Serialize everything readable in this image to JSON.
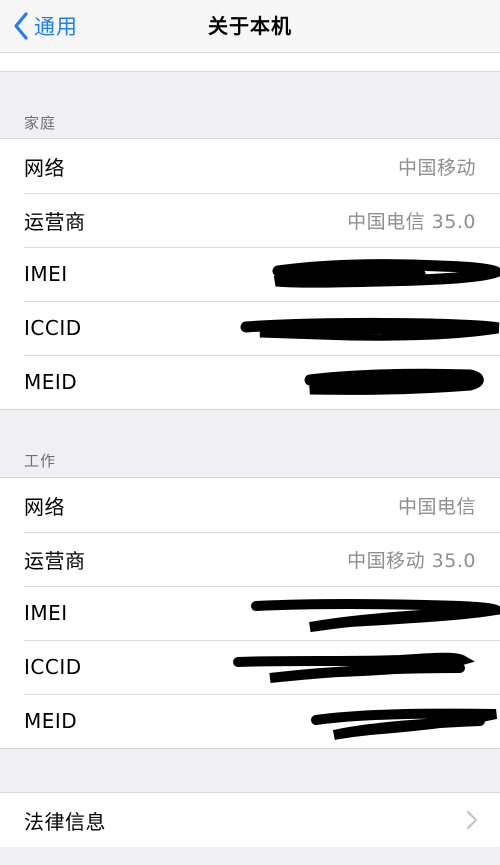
{
  "navbar": {
    "back_label": "通用",
    "title": "关于本机"
  },
  "sections": [
    {
      "header": "家庭",
      "rows": [
        {
          "label": "网络",
          "value": "中国移动"
        },
        {
          "label": "运营商",
          "value": "中国电信 35.0"
        },
        {
          "label": "IMEI",
          "value": ""
        },
        {
          "label": "ICCID",
          "value": ""
        },
        {
          "label": "MEID",
          "value": ""
        }
      ]
    },
    {
      "header": "工作",
      "rows": [
        {
          "label": "网络",
          "value": "中国电信"
        },
        {
          "label": "运营商",
          "value": "中国移动 35.0"
        },
        {
          "label": "IMEI",
          "value": ""
        },
        {
          "label": "ICCID",
          "value": ""
        },
        {
          "label": "MEID",
          "value": ""
        }
      ]
    }
  ],
  "legal": {
    "label": "法律信息"
  },
  "icons": {
    "back": "chevron-left-icon",
    "disclosure": "chevron-right-icon"
  },
  "colors": {
    "accent": "#1f7ef6",
    "secondary_text": "#8e8e93",
    "background": "#efeff4"
  }
}
